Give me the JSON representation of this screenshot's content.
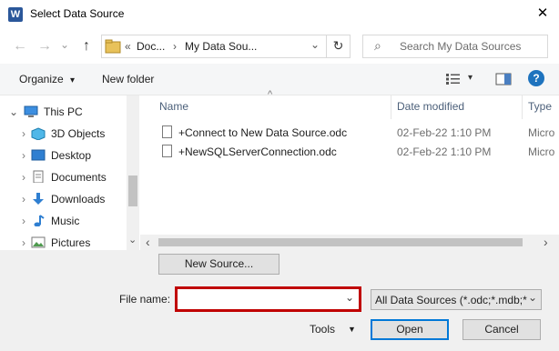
{
  "window": {
    "title": "Select Data Source",
    "app_icon": "W",
    "close_glyph": "✕"
  },
  "nav": {
    "back": "←",
    "forward": "→",
    "dropdown": "⌄",
    "up": "↑",
    "refresh": "↻"
  },
  "address": {
    "chevrons": "«",
    "crumbs": [
      "Doc...",
      "My Data Sou..."
    ],
    "sep": "›",
    "dropdown": "⌄"
  },
  "search": {
    "placeholder": "Search My Data Sources",
    "icon": "⌕"
  },
  "toolbar": {
    "organize": "Organize",
    "organize_arrow": "▾",
    "new_folder": "New folder",
    "view_arrow": "▾",
    "help": "?"
  },
  "sidebar": {
    "items": [
      {
        "label": "This PC",
        "icon": "computer-icon"
      },
      {
        "label": "3D Objects",
        "icon": "cube-icon"
      },
      {
        "label": "Desktop",
        "icon": "desktop-icon"
      },
      {
        "label": "Documents",
        "icon": "documents-icon"
      },
      {
        "label": "Downloads",
        "icon": "downloads-icon"
      },
      {
        "label": "Music",
        "icon": "music-icon"
      },
      {
        "label": "Pictures",
        "icon": "pictures-icon"
      }
    ],
    "expand_glyph": "›"
  },
  "columns": {
    "name": "Name",
    "date": "Date modified",
    "type": "Type",
    "sort_glyph": "^"
  },
  "files": [
    {
      "name": "+Connect to New Data Source.odc",
      "date": "02-Feb-22 1:10 PM",
      "type": "Micro"
    },
    {
      "name": "+NewSQLServerConnection.odc",
      "date": "02-Feb-22 1:10 PM",
      "type": "Micro"
    }
  ],
  "scroll": {
    "left": "‹",
    "right": "›",
    "down": "⌄"
  },
  "footer": {
    "new_source": "New Source...",
    "file_name_label": "File name:",
    "file_name_value": "",
    "file_type": "All Data Sources (*.odc;*.mdb;*",
    "tools": "Tools",
    "tools_arrow": "▼",
    "open": "Open",
    "cancel": "Cancel",
    "dropdown": "⌄"
  },
  "colors": {
    "accent": "#0078d7",
    "highlight": "#c00000",
    "link": "#1e3287"
  }
}
